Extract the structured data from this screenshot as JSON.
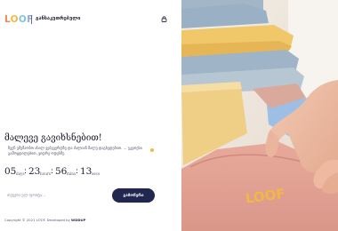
{
  "header": {
    "logo_letters": [
      "L",
      "O",
      "O",
      "F"
    ],
    "brand_text": "განსაკუთრებული",
    "lock_icon": "lock-icon"
  },
  "hero": {
    "headline": "მალევე გავიხსნებით!",
    "subtext": "ჩვენ ვმუშაობთ ახალ ვებგვერდზე და ძალიან მალე დაგხვდებით. ... უკეთესი გამოცდილებით, ვიდრე ოდესმე."
  },
  "countdown": {
    "days": "05",
    "days_label": "days",
    "hours": "23",
    "hours_label": "hours",
    "minutes": "56",
    "minutes_label": "mins",
    "seconds": "13",
    "seconds_label": "secs"
  },
  "subscribe": {
    "placeholder": "თქვენი ელ-ფოსტა...",
    "button_label": "გამოწერა"
  },
  "footer": {
    "copyright": "Copyright © 2021 LOOF. Developed by",
    "developer": "WDDUP"
  },
  "photo": {
    "shirt_print": "LOOF"
  },
  "colors": {
    "accent_dark": "#222750",
    "logo_orange": "#f08a54",
    "logo_yellow": "#f2b843",
    "logo_teal": "#7fc6d8",
    "logo_lavender": "#9ba9e0"
  }
}
